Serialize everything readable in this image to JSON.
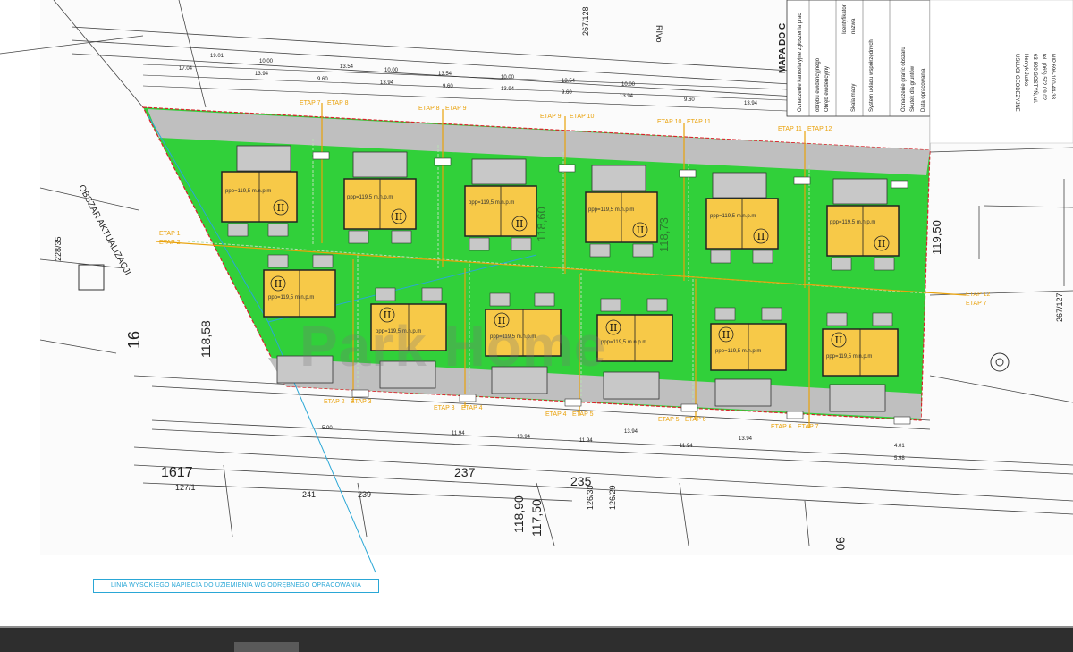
{
  "map": {
    "title": "MAPA DO C",
    "watermark": "Park Home",
    "area_label": "OBSZAR AKTUALIZACJI",
    "parcel_228": "228/35",
    "parcel_267_128": "267/128",
    "parcel_267_127": "267/127",
    "hv_line_label": "LINIA WYSOKIEGO NAPIĘCIA DO UZIEMIENIA WG ODRĘBNEGO OPRACOWANIA",
    "road_label": "RIVo",
    "numbers": {
      "n237": "237",
      "n235": "235",
      "n239": "239",
      "n241": "241",
      "n1617": "1617",
      "n127_1": "127/1",
      "n126_30": "126/30",
      "n126_29": "126/29",
      "n90": "90",
      "n16": "16",
      "n11958": "118,58",
      "n11950": "119,50",
      "n11860": "118,60",
      "n11873": "118,73",
      "n11890": "118,90",
      "n11750": "117,50"
    },
    "etap_labels": [
      "ETAP 1",
      "ETAP 2",
      "ETAP 7",
      "ETAP 8",
      "ETAP 8",
      "ETAP 9",
      "ETAP 9",
      "ETAP 10",
      "ETAP 10",
      "ETAP 11",
      "ETAP 11",
      "ETAP 12",
      "ETAP 12",
      "ETAP 7",
      "ETAP 2",
      "ETAP 3",
      "ETAP 3",
      "ETAP 4",
      "ETAP 4",
      "ETAP 5",
      "ETAP 5",
      "ETAP 6",
      "ETAP 6",
      "ETAP 7"
    ],
    "house_label": "ppp=119,5 m.n.p.m",
    "house_roman": "II",
    "dims_top": [
      "19.01",
      "10.00",
      "13.54",
      "10.00",
      "13.54",
      "10.00",
      "13.54",
      "10.00",
      "17.04",
      "13.94",
      "9.60",
      "13.94",
      "9.60",
      "13.94",
      "9.60",
      "13.94",
      "9.60",
      "13.94"
    ],
    "dims_bottom": [
      "5.00",
      "11.94",
      "13.94",
      "11.94",
      "13.94",
      "11.94",
      "13.94",
      "4.01",
      "5.98"
    ],
    "legend_rows": [
      "Oznaczenie kancelaryjne zgłoszenia prac",
      "Identyfikator",
      "obrębu ewidencyjnego",
      "nazwa",
      "Obręb ewidencyjny",
      "Skala mapy",
      "System układu współrzędnych",
      "Oznaczenie granic obszaru",
      "Skutek dla gruntów",
      "Data opracowania"
    ],
    "company": [
      "USŁUGI GEODEZYJNE",
      "Henryk Jusko",
      "63-800 GOSTYŃ, ul.",
      "tel. (065) 572 09 02",
      "NIP 696-100-44-33"
    ]
  },
  "colors": {
    "green": "#31d03a",
    "house": "#f7c948",
    "road": "#bfbfbf",
    "etap": "#e9a20b",
    "hv": "#2aa7d6",
    "boundary": "#d8222a"
  }
}
